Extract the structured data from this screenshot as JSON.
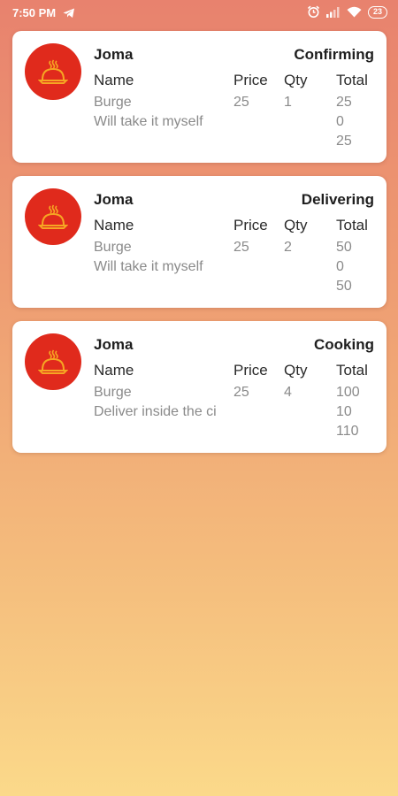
{
  "status_bar": {
    "time": "7:50 PM",
    "battery": "23",
    "icons": [
      "telegram-icon",
      "alarm-icon",
      "signal-icon",
      "wifi-icon",
      "battery-icon"
    ]
  },
  "colors": {
    "avatar_bg": "#e02a1c",
    "avatar_icon": "#f6a623",
    "gradient_top": "#e8826e",
    "gradient_bottom": "#fbd98a"
  },
  "table_headers": {
    "name": "Name",
    "price": "Price",
    "qty": "Qty",
    "total": "Total"
  },
  "orders": [
    {
      "shop": "Joma",
      "status": "Confirming",
      "item": "Burge",
      "price": "25",
      "qty": "1",
      "delivery": "Will take it myself",
      "subtotal": "25",
      "delivery_fee": "0",
      "grand_total": "25"
    },
    {
      "shop": "Joma",
      "status": "Delivering",
      "item": "Burge",
      "price": "25",
      "qty": "2",
      "delivery": "Will take it myself",
      "subtotal": "50",
      "delivery_fee": "0",
      "grand_total": "50"
    },
    {
      "shop": "Joma",
      "status": "Cooking",
      "item": "Burge",
      "price": "25",
      "qty": "4",
      "delivery": "Deliver inside the ci",
      "subtotal": "100",
      "delivery_fee": "10",
      "grand_total": "110"
    }
  ]
}
